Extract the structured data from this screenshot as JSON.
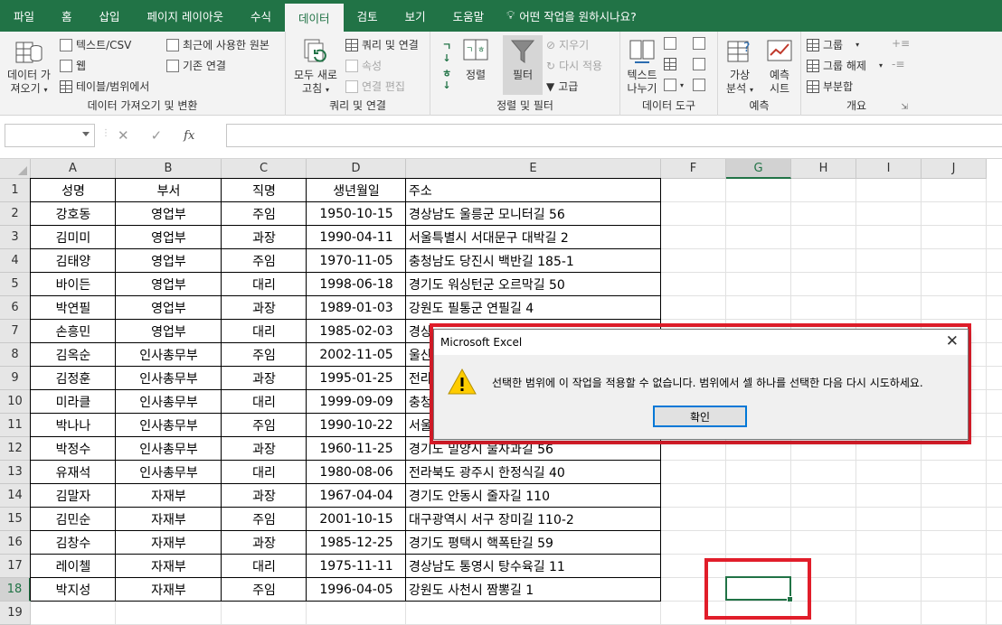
{
  "tabs": [
    "파일",
    "홈",
    "삽입",
    "페이지 레이아웃",
    "수식",
    "데이터",
    "검토",
    "보기",
    "도움말"
  ],
  "tell_me": "어떤 작업을 원하시나요?",
  "ribbon": {
    "get_data_line1": "데이터 가",
    "get_data_line2": "져오기",
    "text_csv": "텍스트/CSV",
    "web": "웹",
    "table_range": "테이블/범위에서",
    "recent_sources": "최근에 사용한 원본",
    "existing_connections": "기존 연결",
    "group_get": "데이터 가져오기 및 변환",
    "refresh_line1": "모두 새로",
    "refresh_line2": "고침",
    "queries_connections": "쿼리 및 연결",
    "properties": "속성",
    "edit_links": "연결 편집",
    "group_queries": "쿼리 및 연결",
    "sort": "정렬",
    "filter": "필터",
    "clear": "지우기",
    "reapply": "다시 적용",
    "advanced": "고급",
    "group_sort": "정렬 및 필터",
    "text_columns_line1": "텍스트",
    "text_columns_line2": "나누기",
    "group_tools": "데이터 도구",
    "whatif_line1": "가상",
    "whatif_line2": "분석",
    "forecast_line1": "예측",
    "forecast_line2": "시트",
    "group_forecast": "예측",
    "group_btn": "그룹",
    "ungroup_btn": "그룹 해제",
    "subtotal": "부분합",
    "group_outline": "개요"
  },
  "formula_bar": {
    "name_box": "",
    "cancel": "✕",
    "enter": "✓",
    "fx": "fx",
    "content": ""
  },
  "columns": [
    "A",
    "B",
    "C",
    "D",
    "E",
    "F",
    "G",
    "H",
    "I",
    "J"
  ],
  "rows": [
    "1",
    "2",
    "3",
    "4",
    "5",
    "6",
    "7",
    "8",
    "9",
    "10",
    "11",
    "12",
    "13",
    "14",
    "15",
    "16",
    "17",
    "18",
    "19"
  ],
  "table": {
    "headers": [
      "성명",
      "부서",
      "직명",
      "생년월일",
      "주소"
    ],
    "data": [
      [
        "강호동",
        "영업부",
        "주임",
        "1950-10-15",
        "경상남도 울릉군 모니터길 56"
      ],
      [
        "김미미",
        "영업부",
        "과장",
        "1990-04-11",
        "서울특별시 서대문구 대박길 2"
      ],
      [
        "김태양",
        "영업부",
        "주임",
        "1970-11-05",
        "충청남도 당진시 백반길 185-1"
      ],
      [
        "바이든",
        "영업부",
        "대리",
        "1998-06-18",
        "경기도 워싱턴군 오르막길 50"
      ],
      [
        "박연필",
        "영업부",
        "과장",
        "1989-01-03",
        "강원도 필통군 연필길 4"
      ],
      [
        "손흥민",
        "영업부",
        "대리",
        "1985-02-03",
        "경상"
      ],
      [
        "김옥순",
        "인사총무부",
        "주임",
        "2002-11-05",
        "울산"
      ],
      [
        "김정훈",
        "인사총무부",
        "과장",
        "1995-01-25",
        "전라"
      ],
      [
        "미라클",
        "인사총무부",
        "대리",
        "1999-09-09",
        "충청"
      ],
      [
        "박나나",
        "인사총무부",
        "주임",
        "1990-10-22",
        "서울"
      ],
      [
        "박정수",
        "인사총무부",
        "과장",
        "1960-11-25",
        "경기도 밀양시 물자과길 56"
      ],
      [
        "유재석",
        "인사총무부",
        "대리",
        "1980-08-06",
        "전라북도 광주시 한정식길 40"
      ],
      [
        "김말자",
        "자재부",
        "과장",
        "1967-04-04",
        "경기도 안동시 줄자길 110"
      ],
      [
        "김민순",
        "자재부",
        "주임",
        "2001-10-15",
        "대구광역시 서구 장미길 110-2"
      ],
      [
        "김창수",
        "자재부",
        "과장",
        "1985-12-25",
        "경기도 평택시 핵폭탄길 59"
      ],
      [
        "레이첼",
        "자재부",
        "대리",
        "1975-11-11",
        "경상남도 통영시 탕수육길 11"
      ],
      [
        "박지성",
        "자재부",
        "주임",
        "1996-04-05",
        "강원도 사천시 짬뽕길 1"
      ]
    ]
  },
  "dialog": {
    "title": "Microsoft Excel",
    "message": "선택한 범위에 이 작업을 적용할 수 없습니다. 범위에서 셀 하나를 선택한 다음 다시 시도하세요.",
    "ok": "확인",
    "close": "✕"
  },
  "colors": {
    "excel_green": "#217346",
    "highlight_red": "#e11d2a",
    "dialog_button_border": "#0078d7"
  }
}
